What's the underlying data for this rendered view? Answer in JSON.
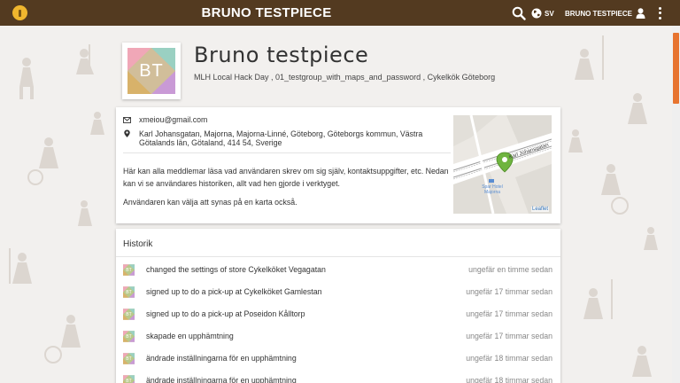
{
  "header": {
    "title": "BRUNO TESTPIECE",
    "language": "SV",
    "user_name": "BRUNO TESTPIECE"
  },
  "colors": {
    "topbar": "#533a20",
    "accent": "#e7742f",
    "logo": "#f0b62e"
  },
  "profile": {
    "initials": "BT",
    "name": "Bruno testpiece",
    "groups": "MLH Local Hack Day , 01_testgroup_with_maps_and_password , Cykelkök Göteborg"
  },
  "info": {
    "email": "xmeiou@gmail.com",
    "address": "Karl Johansgatan, Majorna, Majorna-Linné, Göteborg, Göteborgs kommun, Västra Götalands län, Götaland, 414 54, Sverige",
    "description": "Här kan alla meddlemar läsa vad användaren skrev om sig själv, kontaktsuppgifter, etc. Nedan kan vi se användares historiken, allt vad hen gjorde i verktyget.",
    "description2": "Användaren kan välja att synas på en karta också.",
    "map": {
      "street": "Karl Johansgatan",
      "poi": "Spar Hotel Majorna",
      "attribution": "Leaflet"
    }
  },
  "history": {
    "title": "Historik",
    "items": [
      {
        "text": "changed the settings of store Cykelköket Vegagatan",
        "time": "ungefär en timme sedan"
      },
      {
        "text": "signed up to do a pick-up at Cykelköket Gamlestan",
        "time": "ungefär 17 timmar sedan"
      },
      {
        "text": "signed up to do a pick-up at Poseidon Kålltorp",
        "time": "ungefär 17 timmar sedan"
      },
      {
        "text": "skapade en upphämtning",
        "time": "ungefär 17 timmar sedan"
      },
      {
        "text": "ändrade inställningarna för en upphämtning",
        "time": "ungefär 18 timmar sedan"
      },
      {
        "text": "ändrade inställningarna för en upphämtning",
        "time": "ungefär 18 timmar sedan"
      }
    ]
  }
}
